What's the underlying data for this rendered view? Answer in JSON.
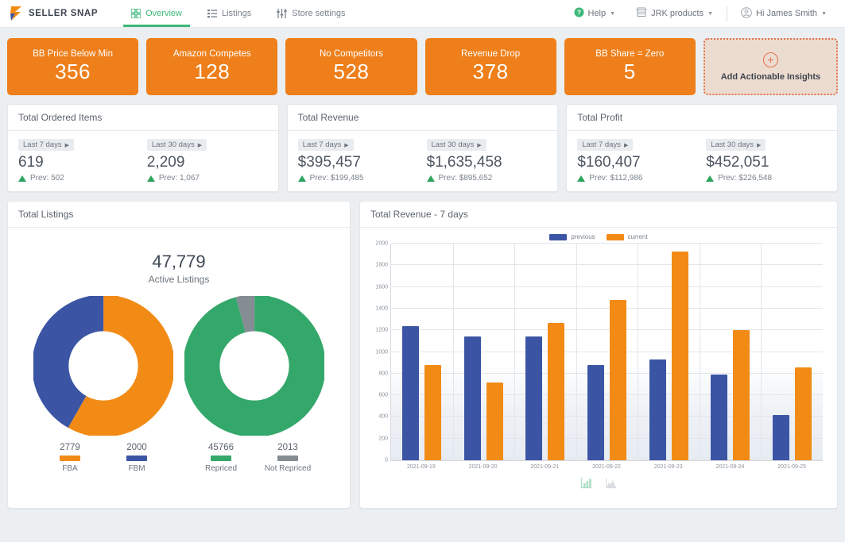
{
  "header": {
    "brand": "SELLER SNAP",
    "nav": [
      {
        "label": "Overview",
        "icon": "grid-icon",
        "active": true
      },
      {
        "label": "Listings",
        "icon": "list-icon",
        "active": false
      },
      {
        "label": "Store settings",
        "icon": "sliders-icon",
        "active": false
      }
    ],
    "help": "Help",
    "store": "JRK products",
    "user": "Hi James Smith"
  },
  "insights": {
    "cards": [
      {
        "label": "BB Price Below Min",
        "value": "356"
      },
      {
        "label": "Amazon Competes",
        "value": "128"
      },
      {
        "label": "No Competitors",
        "value": "528"
      },
      {
        "label": "Revenue Drop",
        "value": "378"
      },
      {
        "label": "BB Share = Zero",
        "value": "5"
      }
    ],
    "add_label": "Add Actionable Insights",
    "add_icon": "plus-circle-icon",
    "accent": "#ee7f1a"
  },
  "stats": [
    {
      "title": "Total Ordered Items",
      "left": {
        "range": "Last 7 days",
        "value": "619",
        "prev": "Prev: 502"
      },
      "right": {
        "range": "Last 30 days",
        "value": "2,209",
        "prev": "Prev: 1,067"
      }
    },
    {
      "title": "Total Revenue",
      "left": {
        "range": "Last 7 days",
        "value": "$395,457",
        "prev": "Prev: $199,485"
      },
      "right": {
        "range": "Last 30 days",
        "value": "$1,635,458",
        "prev": "Prev: $895,652"
      }
    },
    {
      "title": "Total Profit",
      "left": {
        "range": "Last 7 days",
        "value": "$160,407",
        "prev": "Prev: $112,986"
      },
      "right": {
        "range": "Last 30 days",
        "value": "$452,051",
        "prev": "Prev: $226,548"
      }
    }
  ],
  "listings": {
    "title": "Total Listings",
    "total_value": "47,779",
    "total_label": "Active Listings",
    "legend": [
      {
        "num": "2779",
        "label": "FBA",
        "color": "#f28b16"
      },
      {
        "num": "2000",
        "label": "FBM",
        "color": "#3b55a4"
      },
      {
        "num": "45766",
        "label": "Repriced",
        "color": "#34a86b"
      },
      {
        "num": "2013",
        "label": "Not Repriced",
        "color": "#858c93"
      }
    ]
  },
  "chart_data": [
    {
      "type": "pie",
      "title": "Fulfilment split",
      "labels": [
        "FBA",
        "FBM"
      ],
      "values": [
        2779,
        2000
      ],
      "colors": [
        "#f28b16",
        "#3b55a4"
      ],
      "donut": true,
      "legend": "bottom"
    },
    {
      "type": "pie",
      "title": "Repricing split",
      "labels": [
        "Repriced",
        "Not Repriced"
      ],
      "values": [
        45766,
        2013
      ],
      "colors": [
        "#34a86b",
        "#858c93"
      ],
      "donut": true,
      "legend": "bottom"
    },
    {
      "type": "bar",
      "title": "Total Revenue - 7 days",
      "categories": [
        "2021-09-19",
        "2021-09-20",
        "2021-09-21",
        "2021-09-22",
        "2021-09-23",
        "2021-09-24",
        "2021-09-25"
      ],
      "series": [
        {
          "name": "previous",
          "color": "#3b55a4",
          "values": [
            1240,
            1140,
            1140,
            880,
            930,
            790,
            420
          ]
        },
        {
          "name": "current",
          "color": "#f28b16",
          "values": [
            880,
            720,
            1270,
            1480,
            1930,
            1200,
            860
          ]
        }
      ],
      "xlabel": "",
      "ylabel": "",
      "ylim": [
        0,
        2000
      ],
      "yticks": [
        0,
        200,
        400,
        600,
        800,
        1000,
        1200,
        1400,
        1600,
        1800,
        2000
      ],
      "grid": true,
      "legend": "top"
    }
  ],
  "revenue": {
    "title": "Total Revenue - 7 days",
    "tools": [
      {
        "name": "bar-chart-icon",
        "active": true
      },
      {
        "name": "area-chart-icon",
        "active": false
      }
    ]
  }
}
